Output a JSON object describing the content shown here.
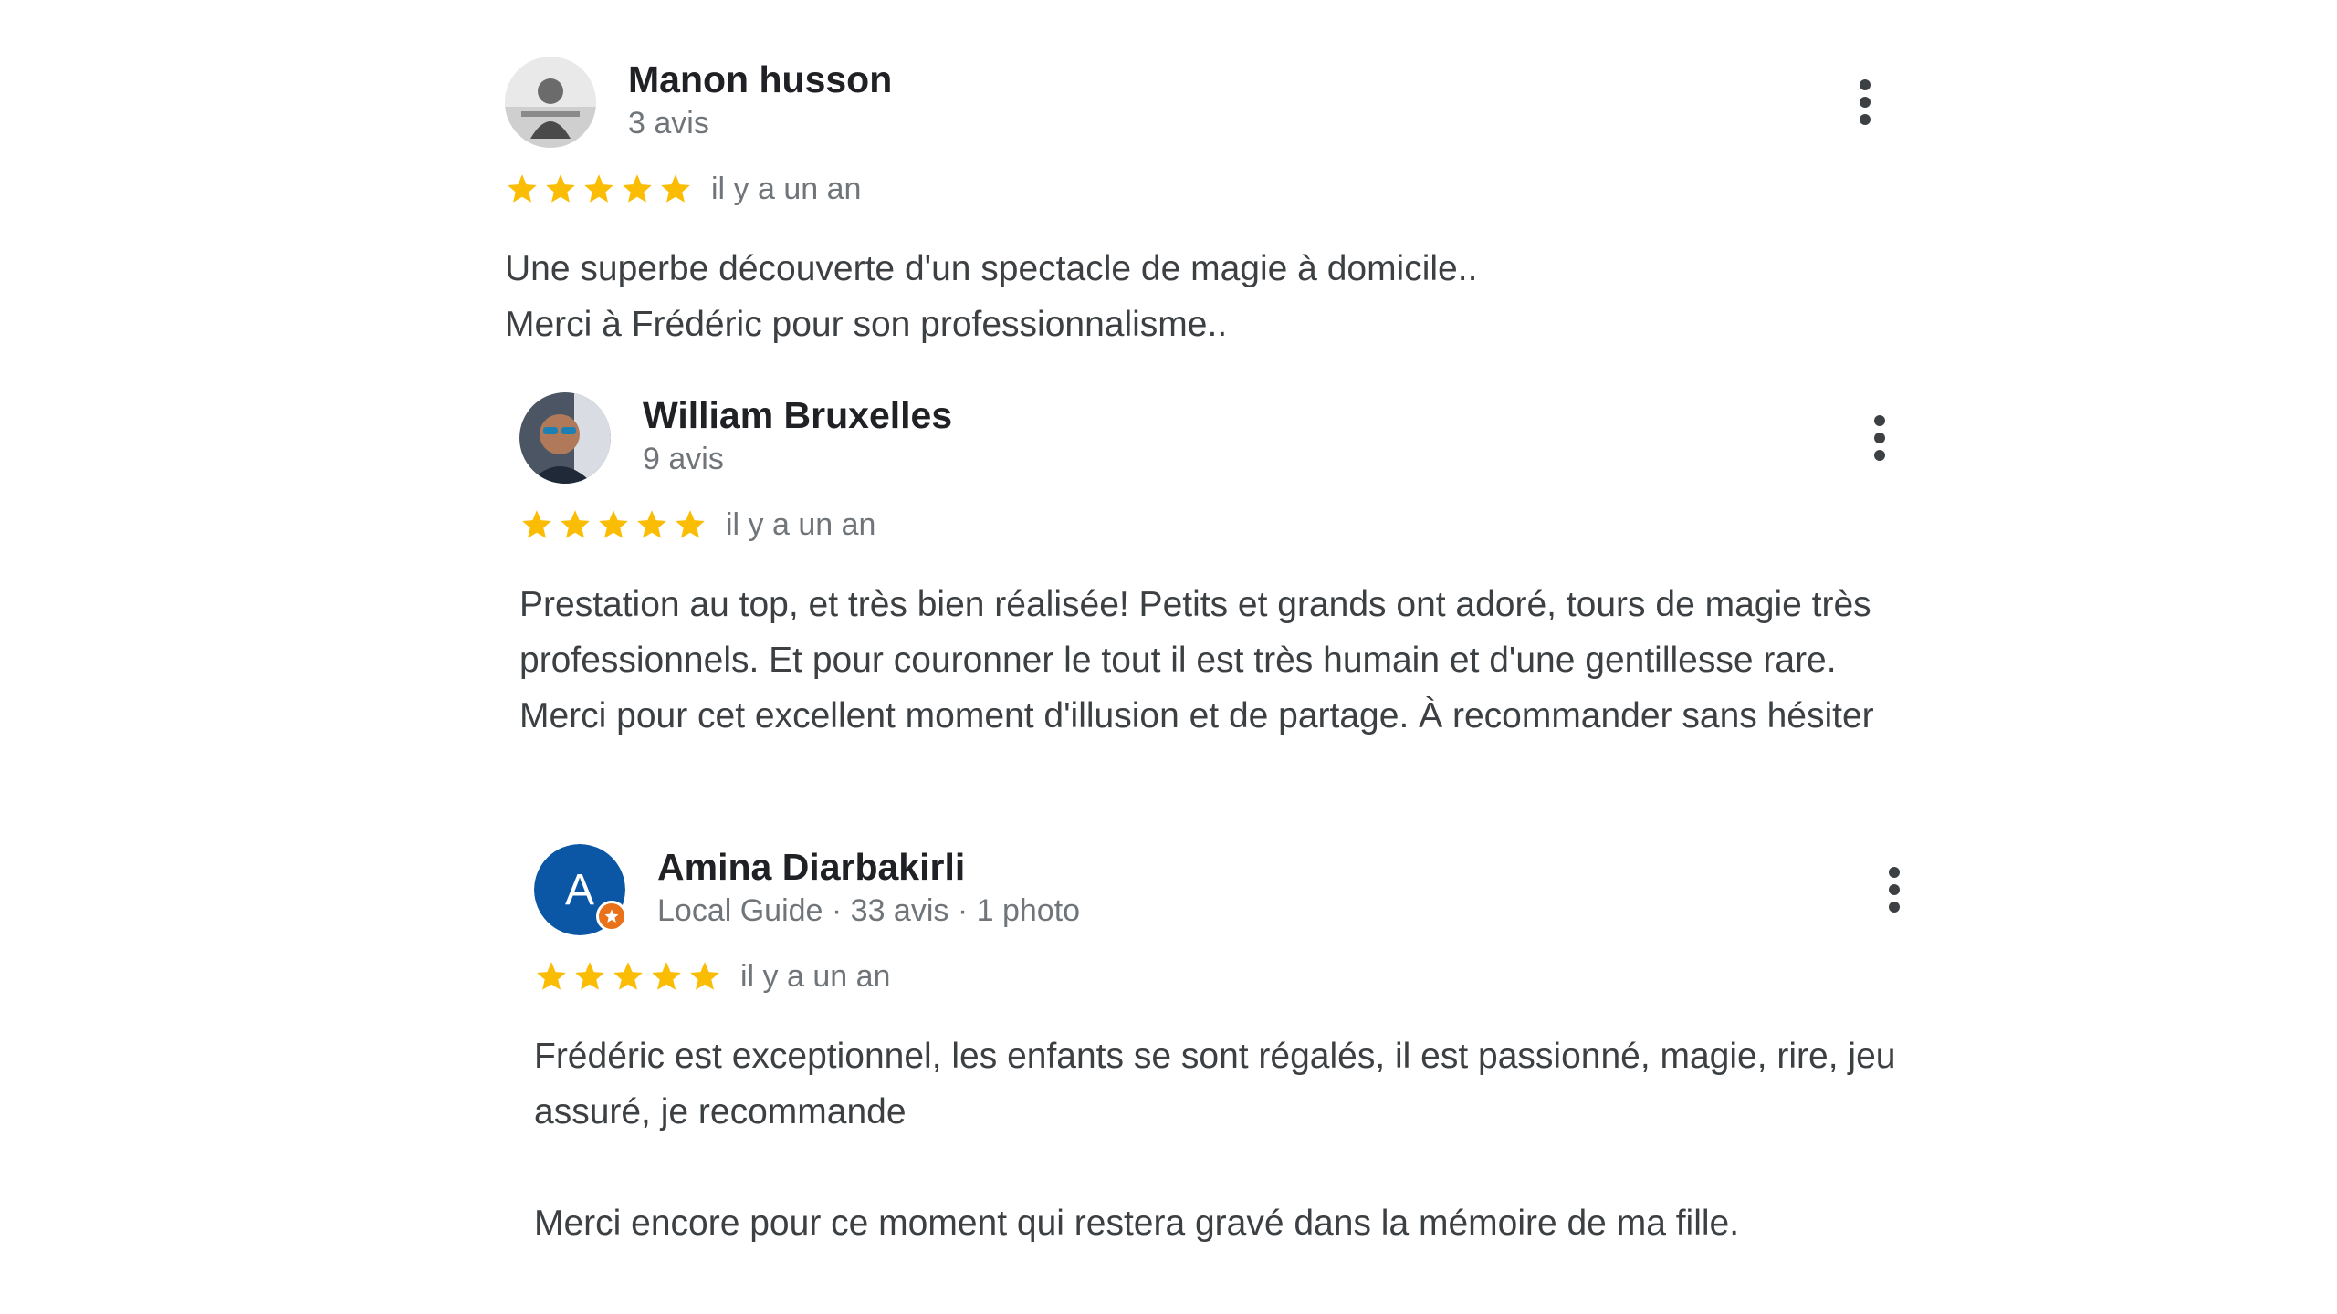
{
  "reviews": [
    {
      "name": "Manon husson",
      "meta": "3 avis",
      "rating": 5,
      "when": "il y a un an",
      "text": "Une superbe découverte d'un spectacle de magie à domicile..\nMerci à Frédéric pour son professionnalisme..",
      "avatar_type": "photo"
    },
    {
      "name": "William Bruxelles",
      "meta": "9 avis",
      "rating": 5,
      "when": "il y a un an",
      "text": "Prestation au top, et très bien réalisée! Petits et grands ont adoré, tours de magie très professionnels. Et pour couronner le tout il est très humain et d'une gentillesse rare. Merci pour cet excellent moment d'illusion et de partage. À recommander sans hésiter",
      "avatar_type": "photo"
    },
    {
      "name": "Amina Diarbakirli",
      "meta": "Local Guide · 33 avis · 1 photo",
      "rating": 5,
      "when": "il y a un an",
      "text": "Frédéric est exceptionnel, les enfants se sont régalés, il est passionné, magie, rire, jeu assuré, je recommande\n\nMerci encore pour ce moment qui restera gravé dans la mémoire de ma fille.",
      "avatar_type": "initial",
      "avatar_initial": "A",
      "avatar_color": "#0b57a6",
      "local_guide_badge_color": "#e8711a"
    }
  ],
  "colors": {
    "star": "#fbbc04",
    "name": "#202124",
    "meta": "#70757a",
    "text": "#3c4043"
  },
  "icons": {
    "more": "more-vert-icon",
    "star": "star-icon",
    "local_guide": "local-guide-badge-icon"
  }
}
